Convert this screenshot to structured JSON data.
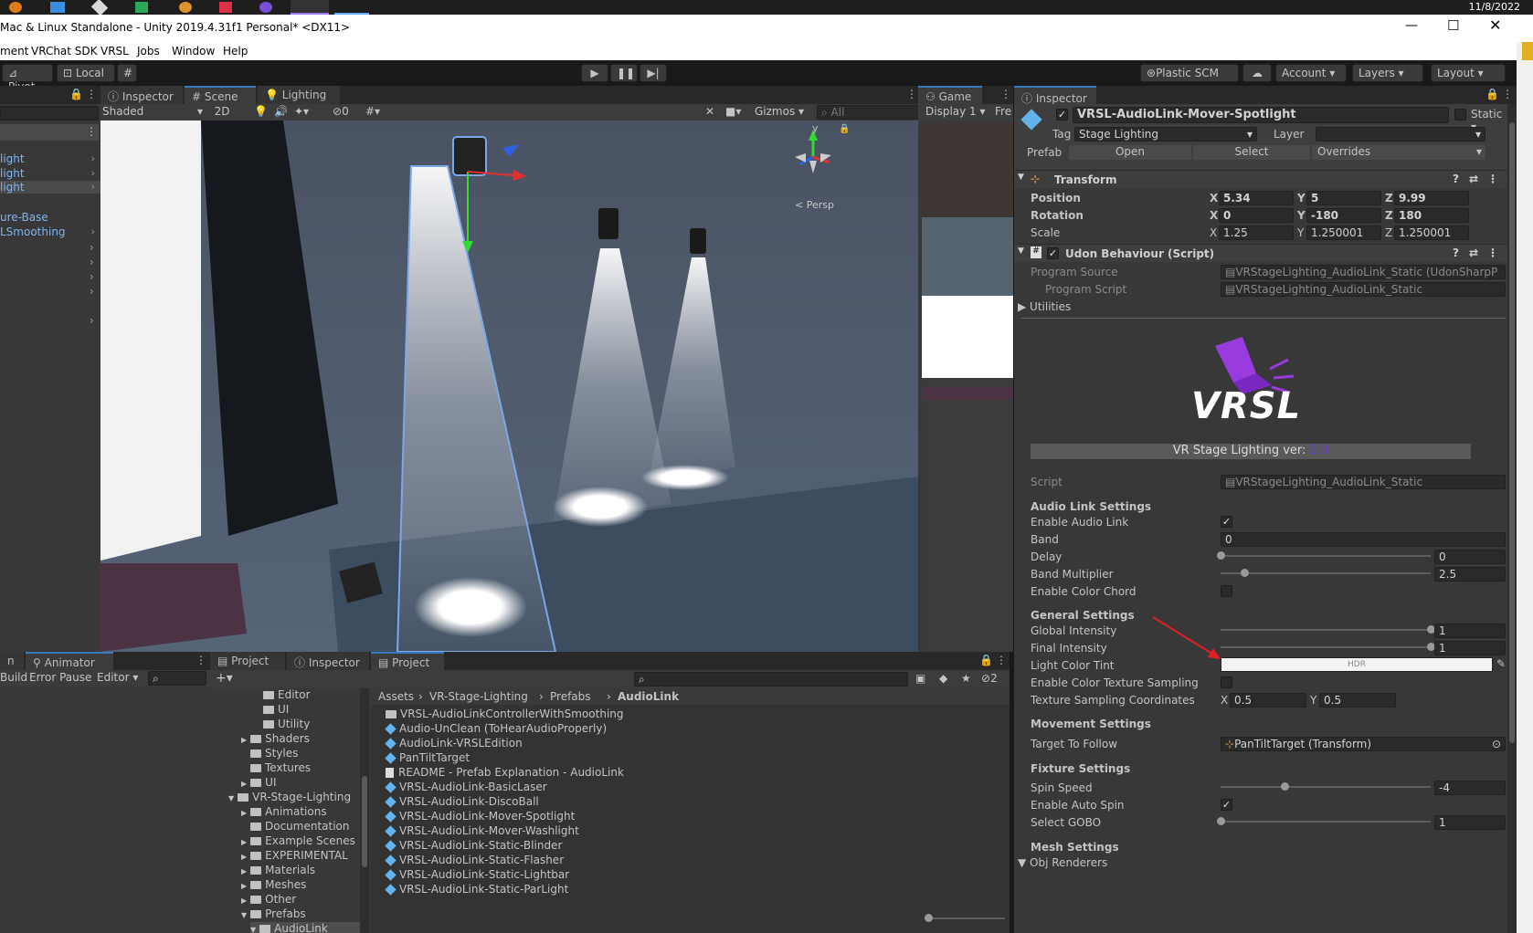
{
  "taskbar": {
    "date": "11/8/2022"
  },
  "window": {
    "title": "Mac & Linux Standalone - Unity 2019.4.31f1 Personal* <DX11>"
  },
  "menu": [
    "ment",
    "VRChat SDK",
    "VRSL",
    "Jobs",
    "Window",
    "Help"
  ],
  "toolbar": {
    "pivot": "Pivot",
    "local": "Local",
    "plastic": "Plastic SCM",
    "account": "Account",
    "layers": "Layers",
    "layout": "Layout"
  },
  "hierarchy": {
    "items": [
      "light",
      "light",
      "light",
      "ure-Base",
      "LSmoothing"
    ]
  },
  "scene": {
    "tabs": {
      "inspector": "Inspector",
      "scene": "Scene",
      "lighting": "Lighting"
    },
    "shading": "Shaded",
    "mode_2d": "2D",
    "hidden_count": "0",
    "gizmos": "Gizmos",
    "search_placeholder": "All",
    "persp": "Persp",
    "axis_y": "y"
  },
  "game": {
    "tab": "Game",
    "display": "Display 1",
    "free": "Fre"
  },
  "bottom_left": {
    "tab_partial": "n",
    "animator": "Animator",
    "build": "Build",
    "error_pause": "Error Pause",
    "editor": "Editor"
  },
  "project": {
    "tabs": {
      "project1": "Project",
      "inspector": "Inspector",
      "project2": "Project"
    },
    "hidden_count": "2",
    "breadcrumb": [
      "Assets",
      "VR-Stage-Lighting",
      "Prefabs",
      "AudioLink"
    ],
    "tree": [
      {
        "label": "Editor",
        "indent": 3,
        "arrow": ""
      },
      {
        "label": "UI",
        "indent": 3,
        "arrow": ""
      },
      {
        "label": "Utility",
        "indent": 3,
        "arrow": ""
      },
      {
        "label": "Shaders",
        "indent": 2,
        "arrow": "▶"
      },
      {
        "label": "Styles",
        "indent": 2,
        "arrow": ""
      },
      {
        "label": "Textures",
        "indent": 2,
        "arrow": ""
      },
      {
        "label": "UI",
        "indent": 2,
        "arrow": "▶"
      },
      {
        "label": "VR-Stage-Lighting",
        "indent": 1,
        "arrow": "▼"
      },
      {
        "label": "Animations",
        "indent": 2,
        "arrow": "▶"
      },
      {
        "label": "Documentation",
        "indent": 2,
        "arrow": ""
      },
      {
        "label": "Example Scenes",
        "indent": 2,
        "arrow": "▶"
      },
      {
        "label": "EXPERIMENTAL",
        "indent": 2,
        "arrow": "▶"
      },
      {
        "label": "Materials",
        "indent": 2,
        "arrow": "▶"
      },
      {
        "label": "Meshes",
        "indent": 2,
        "arrow": "▶"
      },
      {
        "label": "Other",
        "indent": 2,
        "arrow": "▶"
      },
      {
        "label": "Prefabs",
        "indent": 2,
        "arrow": "▼"
      },
      {
        "label": "AudioLink",
        "indent": 3,
        "arrow": "▼"
      }
    ],
    "files": [
      {
        "label": "VRSL-AudioLinkControllerWithSmoothing",
        "icon": "folder"
      },
      {
        "label": "Audio-UnClean (ToHearAudioProperly)",
        "icon": "prefab"
      },
      {
        "label": "AudioLink-VRSLEdition",
        "icon": "prefab"
      },
      {
        "label": "PanTiltTarget",
        "icon": "prefab"
      },
      {
        "label": "README - Prefab Explanation - AudioLink",
        "icon": "doc"
      },
      {
        "label": "VRSL-AudioLink-BasicLaser",
        "icon": "prefab"
      },
      {
        "label": "VRSL-AudioLink-DiscoBall",
        "icon": "prefab"
      },
      {
        "label": "VRSL-AudioLink-Mover-Spotlight",
        "icon": "prefab"
      },
      {
        "label": "VRSL-AudioLink-Mover-Washlight",
        "icon": "prefab"
      },
      {
        "label": "VRSL-AudioLink-Static-Blinder",
        "icon": "prefab"
      },
      {
        "label": "VRSL-AudioLink-Static-Flasher",
        "icon": "prefab"
      },
      {
        "label": "VRSL-AudioLink-Static-Lightbar",
        "icon": "prefab"
      },
      {
        "label": "VRSL-AudioLink-Static-ParLight",
        "icon": "prefab"
      }
    ]
  },
  "inspector": {
    "tab": "Inspector",
    "object_name": "VRSL-AudioLink-Mover-Spotlight",
    "static": "Static",
    "tag_label": "Tag",
    "tag_value": "Stage Lighting",
    "layer_label": "Layer",
    "prefab_label": "Prefab",
    "open": "Open",
    "select": "Select",
    "overrides": "Overrides",
    "transform": {
      "title": "Transform",
      "position": {
        "label": "Position",
        "x": "5.34",
        "y": "5",
        "z": "9.99"
      },
      "rotation": {
        "label": "Rotation",
        "x": "0",
        "y": "-180",
        "z": "180"
      },
      "scale": {
        "label": "Scale",
        "x": "1.25",
        "y": "1.250001",
        "z": "1.250001"
      }
    },
    "udon": {
      "title": "Udon Behaviour (Script)",
      "program_source_label": "Program Source",
      "program_source": "VRStageLighting_AudioLink_Static (UdonSharpP",
      "program_script_label": "Program Script",
      "program_script": "VRStageLighting_AudioLink_Static",
      "utilities": "Utilities"
    },
    "logo_text": "VRSL",
    "version_label": "VR Stage Lighting ver:",
    "version": "2.0",
    "script_label": "Script",
    "script_value": "VRStageLighting_AudioLink_Static",
    "audio_link": {
      "title": "Audio Link Settings",
      "enable_label": "Enable Audio Link",
      "band_label": "Band",
      "band": "0",
      "delay_label": "Delay",
      "delay": "0",
      "band_mult_label": "Band Multiplier",
      "band_mult": "2.5",
      "color_chord_label": "Enable Color Chord"
    },
    "general": {
      "title": "General Settings",
      "global_label": "Global Intensity",
      "global": "1",
      "final_label": "Final Intensity",
      "final": "1",
      "tint_label": "Light Color Tint",
      "tint_badge": "HDR",
      "tex_sampling_label": "Enable Color Texture Sampling",
      "tex_coords_label": "Texture Sampling Coordinates",
      "tex_x": "0.5",
      "tex_y": "0.5"
    },
    "movement": {
      "title": "Movement Settings",
      "target_label": "Target To Follow",
      "target": "PanTiltTarget (Transform)"
    },
    "fixture": {
      "title": "Fixture Settings",
      "spin_label": "Spin Speed",
      "spin": "-4",
      "auto_spin_label": "Enable Auto Spin",
      "gobo_label": "Select GOBO",
      "gobo": "1"
    },
    "mesh": {
      "title": "Mesh Settings",
      "renderers": "Obj Renderers"
    },
    "axis": {
      "x": "X",
      "y": "Y",
      "z": "Z"
    }
  },
  "colors": {
    "accent": "#3a79bb",
    "link": "#7fb3f2",
    "version": "#6a3bd8",
    "arrow": "#e02020"
  }
}
